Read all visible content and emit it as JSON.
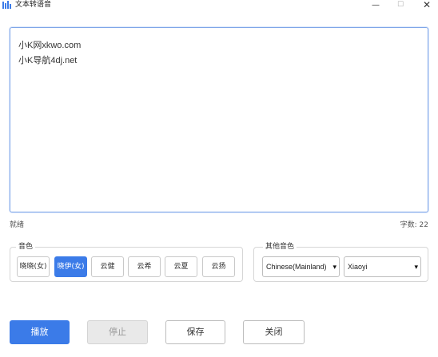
{
  "window": {
    "title": "文本转语音",
    "minimize": "—",
    "maximize": "☐",
    "close": "✕"
  },
  "editor": {
    "lines": [
      "小K网xkwo.com",
      "小K导航4dj.net"
    ]
  },
  "status": {
    "text": "就绪",
    "char_count": "字数: 22"
  },
  "voice_group": {
    "legend": "音色",
    "buttons": [
      "晓晓(女)",
      "晓伊(女)",
      "云健",
      "云希",
      "云夏",
      "云扬"
    ],
    "selected_index": 1
  },
  "other_group": {
    "legend": "其他音色",
    "language_value": "Chinese(Mainland)",
    "voice_value": "Xiaoyi"
  },
  "actions": {
    "play": "播放",
    "stop": "停止",
    "save": "保存",
    "close": "关闭"
  },
  "colors": {
    "accent": "#3b7be8",
    "disabled_bg": "#e9e9e9",
    "editor_border": "#7fa6e8"
  }
}
